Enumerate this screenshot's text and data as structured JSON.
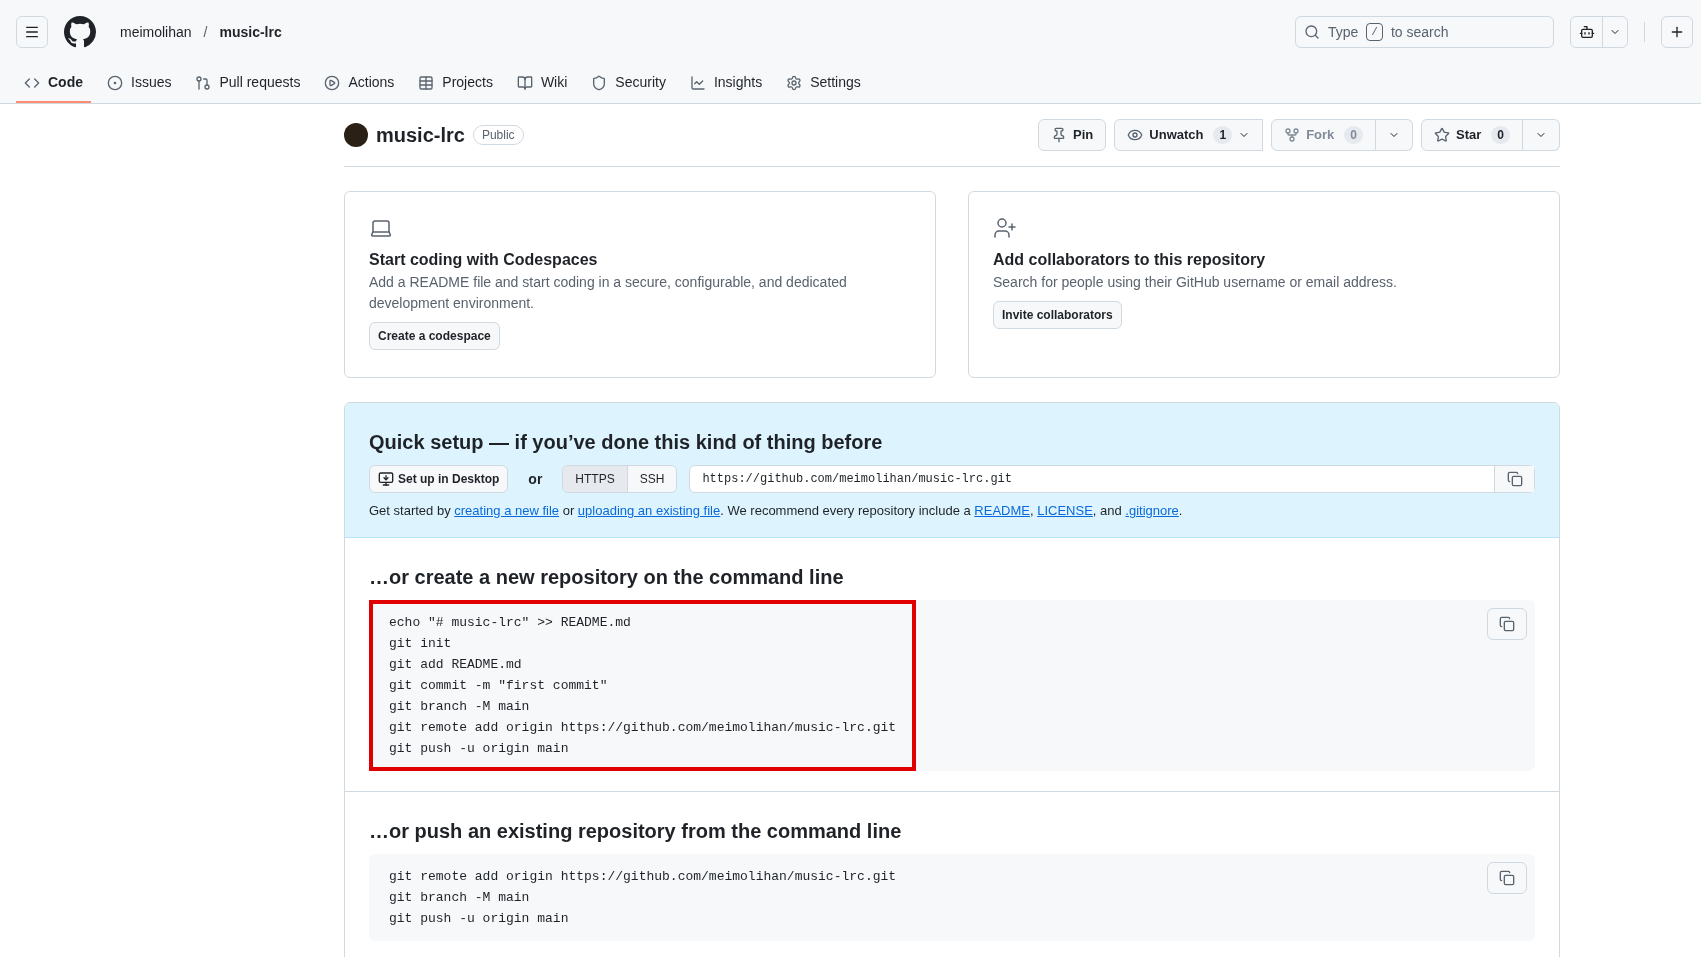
{
  "header": {
    "owner": "meimolihan",
    "separator": "/",
    "repo": "music-lrc",
    "search": {
      "before": "Type",
      "key": "/",
      "after": "to search"
    }
  },
  "tabs": [
    {
      "label": "Code",
      "selected": true
    },
    {
      "label": "Issues",
      "selected": false
    },
    {
      "label": "Pull requests",
      "selected": false
    },
    {
      "label": "Actions",
      "selected": false
    },
    {
      "label": "Projects",
      "selected": false
    },
    {
      "label": "Wiki",
      "selected": false
    },
    {
      "label": "Security",
      "selected": false
    },
    {
      "label": "Insights",
      "selected": false
    },
    {
      "label": "Settings",
      "selected": false
    }
  ],
  "repo": {
    "name": "music-lrc",
    "visibility": "Public",
    "pin": "Pin",
    "watch": {
      "label": "Unwatch",
      "count": "1"
    },
    "fork": {
      "label": "Fork",
      "count": "0",
      "disabled": true
    },
    "star": {
      "label": "Star",
      "count": "0"
    }
  },
  "cards": [
    {
      "title": "Start coding with Codespaces",
      "text": "Add a README file and start coding in a secure, configurable, and dedicated development environment.",
      "button": "Create a codespace"
    },
    {
      "title": "Add collaborators to this repository",
      "text": "Search for people using their GitHub username or email address.",
      "button": "Invite collaborators"
    }
  ],
  "quick_setup": {
    "title": "Quick setup — if you’ve done this kind of thing before",
    "desktop_button": "Set up in Desktop",
    "or": "or",
    "protocols": [
      {
        "label": "HTTPS",
        "selected": true
      },
      {
        "label": "SSH",
        "selected": false
      }
    ],
    "url": "https://github.com/meimolihan/music-lrc.git",
    "hint": [
      {
        "kind": "text",
        "text": "Get started by "
      },
      {
        "kind": "link",
        "text": "creating a new file"
      },
      {
        "kind": "text",
        "text": " or "
      },
      {
        "kind": "link",
        "text": "uploading an existing file"
      },
      {
        "kind": "text",
        "text": ". We recommend every repository include a "
      },
      {
        "kind": "link",
        "text": "README"
      },
      {
        "kind": "text",
        "text": ", "
      },
      {
        "kind": "link",
        "text": "LICENSE"
      },
      {
        "kind": "text",
        "text": ", and "
      },
      {
        "kind": "link",
        "text": ".gitignore"
      },
      {
        "kind": "text",
        "text": "."
      }
    ]
  },
  "sections": [
    {
      "title": "…or create a new repository on the command line",
      "highlighted": true,
      "lines": [
        "echo \"# music-lrc\" >> README.md",
        "git init",
        "git add README.md",
        "git commit -m \"first commit\"",
        "git branch -M main",
        "git remote add origin https://github.com/meimolihan/music-lrc.git",
        "git push -u origin main"
      ]
    },
    {
      "title": "…or push an existing repository from the command line",
      "highlighted": false,
      "lines": [
        "git remote add origin https://github.com/meimolihan/music-lrc.git",
        "git branch -M main",
        "git push -u origin main"
      ]
    }
  ]
}
